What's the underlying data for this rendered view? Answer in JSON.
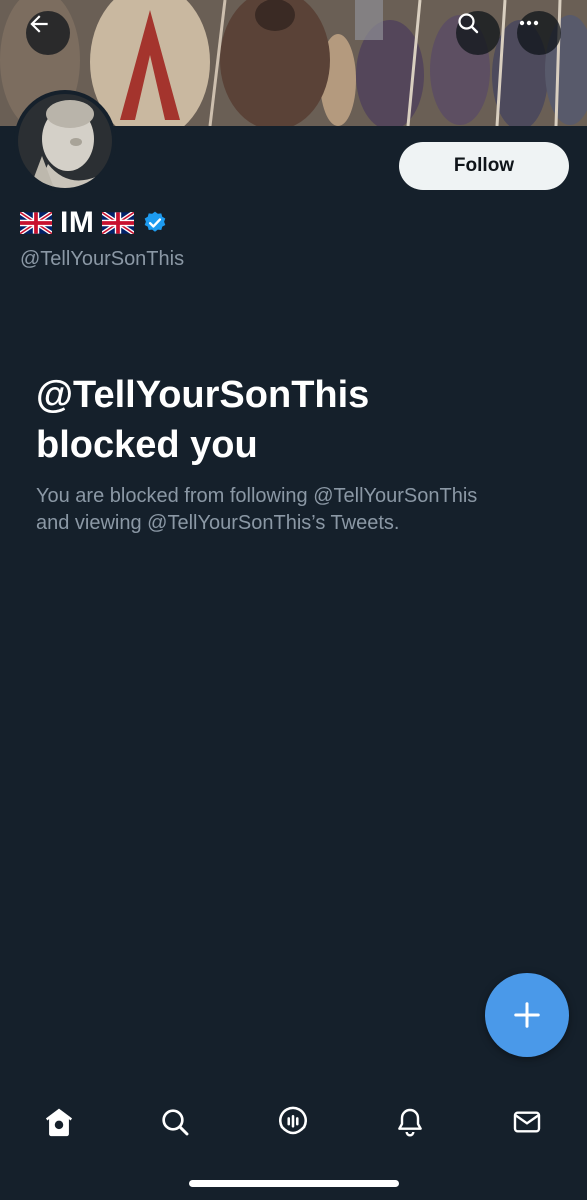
{
  "header": {
    "back_icon": "arrow-left-icon",
    "search_icon": "search-icon",
    "more_icon": "more-horizontal-icon"
  },
  "profile": {
    "name_prefix_flag": "🇬🇧",
    "display_name": "IM",
    "name_suffix_flag": "🇬🇧",
    "verified_icon": "verified-badge-icon",
    "handle": "@TellYourSonThis",
    "follow_label": "Follow"
  },
  "blocked": {
    "title_line1": "@TellYourSonThis",
    "title_line2": "blocked you",
    "desc_line1": "You are blocked from following @TellYourSonThis",
    "desc_line2": "and viewing @TellYourSonThis’s Tweets."
  },
  "fab": {
    "icon": "plus-icon"
  },
  "tabbar": {
    "items": [
      {
        "icon": "home-icon"
      },
      {
        "icon": "search-icon"
      },
      {
        "icon": "spaces-icon"
      },
      {
        "icon": "bell-icon"
      },
      {
        "icon": "mail-icon"
      }
    ]
  },
  "colors": {
    "background": "#15202b",
    "accent": "#4a99e9",
    "secondary_text": "#8b98a5",
    "verified": "#1d9bf0"
  }
}
